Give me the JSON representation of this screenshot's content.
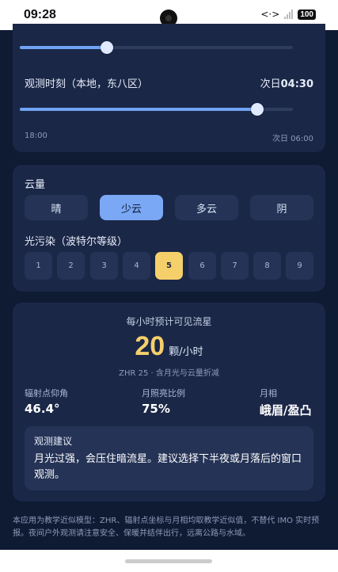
{
  "status": {
    "time": "09:28",
    "battery": "100"
  },
  "slider1": {
    "value_fraction": 0.32
  },
  "obs_time": {
    "label": "观测时刻（本地，东八区）",
    "value_prefix": "次日",
    "value_time": "04:30",
    "value_fraction": 0.87,
    "min_label": "18:00",
    "max_label": "次日 06:00"
  },
  "cloud": {
    "label": "云量",
    "options": [
      "晴",
      "少云",
      "多云",
      "阴"
    ],
    "selected": "少云"
  },
  "light_pollution": {
    "label": "光污染（波特尔等级）",
    "levels": [
      "1",
      "2",
      "3",
      "4",
      "5",
      "6",
      "7",
      "8",
      "9"
    ],
    "selected": "5"
  },
  "estimate": {
    "title": "每小时预计可见流星",
    "count": "20",
    "unit": "颗/小时",
    "note": "ZHR 25 · 含月光与云量折减"
  },
  "stats": {
    "radiant_alt_label": "辐射点仰角",
    "radiant_alt_value": "46.4°",
    "moon_illum_label": "月照亮比例",
    "moon_illum_value": "75%",
    "moon_phase_label": "月相",
    "moon_phase_value": "峨眉/盈凸"
  },
  "advice": {
    "title": "观测建议",
    "body": "月光过强，会压住暗流星。建议选择下半夜或月落后的窗口观测。"
  },
  "footer": "本应用为教学近似模型：ZHR、辐射点坐标与月相均取教学近似值，不替代 IMO 实时预报。夜间户外观测请注意安全、保暖并结伴出行，远离公路与水域。",
  "colors": {
    "accent": "#7aa8f5",
    "highlight": "#f5cf6a",
    "card": "#1b2747",
    "background": "#0f1a33"
  }
}
